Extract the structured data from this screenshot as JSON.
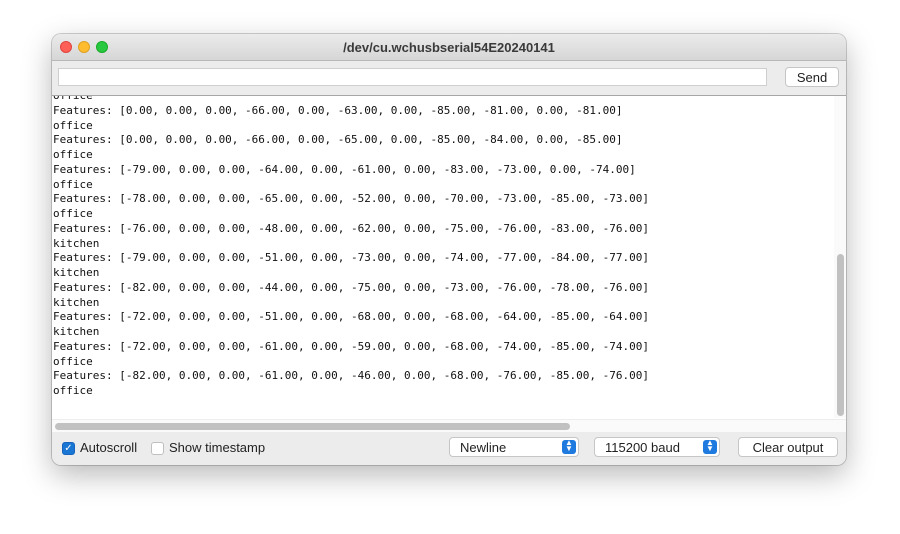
{
  "window": {
    "title": "/dev/cu.wchusbserial54E20240141"
  },
  "toolbar": {
    "input_value": "",
    "send_label": "Send"
  },
  "output": {
    "lines": [
      "office",
      "Features: [0.00, 0.00, 0.00, -66.00, 0.00, -63.00, 0.00, -85.00, -81.00, 0.00, -81.00]",
      "office",
      "Features: [0.00, 0.00, 0.00, -66.00, 0.00, -65.00, 0.00, -85.00, -84.00, 0.00, -85.00]",
      "office",
      "Features: [-79.00, 0.00, 0.00, -64.00, 0.00, -61.00, 0.00, -83.00, -73.00, 0.00, -74.00]",
      "office",
      "Features: [-78.00, 0.00, 0.00, -65.00, 0.00, -52.00, 0.00, -70.00, -73.00, -85.00, -73.00]",
      "office",
      "Features: [-76.00, 0.00, 0.00, -48.00, 0.00, -62.00, 0.00, -75.00, -76.00, -83.00, -76.00]",
      "kitchen",
      "Features: [-79.00, 0.00, 0.00, -51.00, 0.00, -73.00, 0.00, -74.00, -77.00, -84.00, -77.00]",
      "kitchen",
      "Features: [-82.00, 0.00, 0.00, -44.00, 0.00, -75.00, 0.00, -73.00, -76.00, -78.00, -76.00]",
      "kitchen",
      "Features: [-72.00, 0.00, 0.00, -51.00, 0.00, -68.00, 0.00, -68.00, -64.00, -85.00, -64.00]",
      "kitchen",
      "Features: [-72.00, 0.00, 0.00, -61.00, 0.00, -59.00, 0.00, -68.00, -74.00, -85.00, -74.00]",
      "office",
      "Features: [-82.00, 0.00, 0.00, -61.00, 0.00, -46.00, 0.00, -68.00, -76.00, -85.00, -76.00]",
      "office"
    ]
  },
  "footer": {
    "autoscroll": {
      "label": "Autoscroll",
      "checked": true
    },
    "timestamp": {
      "label": "Show timestamp",
      "checked": false
    },
    "line_ending": {
      "selected": "Newline"
    },
    "baud": {
      "selected": "115200 baud"
    },
    "clear_label": "Clear output"
  },
  "colors": {
    "accent": "#1f7ae0",
    "close": "#fe5f57",
    "minimize": "#febc2e",
    "maximize": "#28c840"
  },
  "icons": {
    "check": "checkmark-icon",
    "select_arrows": "chevron-updown-icon"
  }
}
